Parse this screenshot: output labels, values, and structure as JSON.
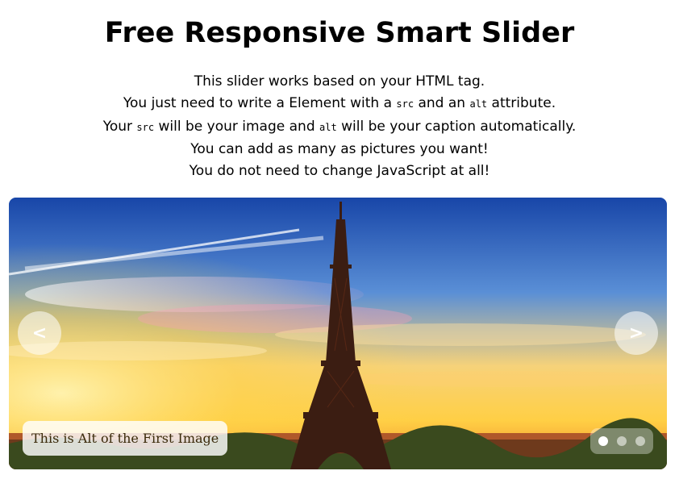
{
  "page": {
    "title": "Free Responsive Smart Slider"
  },
  "intro": {
    "line1": "This slider works based on your HTML tag.",
    "line2": {
      "a": "You just need to write a  Element with a ",
      "code1": "src",
      "b": " and an ",
      "code2": "alt",
      "c": " attribute."
    },
    "line3": {
      "a": "Your ",
      "code1": "src",
      "b": " will be your image and ",
      "code2": "alt",
      "c": " will be your caption automatically."
    },
    "line4": "You can add as many as pictures you want!",
    "line5": "You do not need to change JavaScript at all!"
  },
  "slider": {
    "prev_label": "<",
    "next_label": ">",
    "caption": "This is Alt of the First Image",
    "slide_count": 3,
    "active_slide": 1,
    "image_subject": "eiffel-tower-sunset"
  },
  "colors": {
    "sky_top": "#1846a8",
    "sky_mid": "#5a8fd6",
    "sunset": "#ffd34a",
    "horizon": "#f08a2a",
    "tower": "#3b1d12"
  }
}
